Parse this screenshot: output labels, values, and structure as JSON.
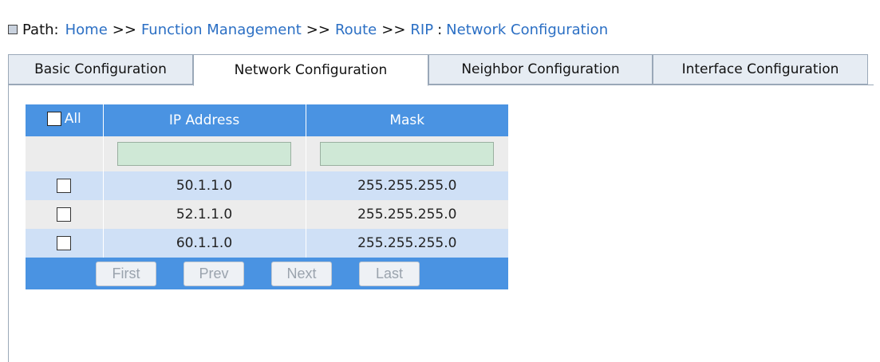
{
  "path": {
    "label": "Path:",
    "crumbs": [
      "Home",
      "Function Management",
      "Route",
      "RIP",
      "Network Configuration"
    ],
    "separator": ">>",
    "colon": ":"
  },
  "tabs": [
    {
      "label": "Basic Configuration",
      "active": false
    },
    {
      "label": "Network Configuration",
      "active": true
    },
    {
      "label": "Neighbor Configuration",
      "active": false
    },
    {
      "label": "Interface Configuration",
      "active": false
    }
  ],
  "table": {
    "headers": {
      "all": "All",
      "ip": "IP Address",
      "mask": "Mask"
    },
    "filter": {
      "ip_value": "",
      "mask_value": ""
    },
    "rows": [
      {
        "ip": "50.1.1.0",
        "mask": "255.255.255.0",
        "checked": false
      },
      {
        "ip": "52.1.1.0",
        "mask": "255.255.255.0",
        "checked": false
      },
      {
        "ip": "60.1.1.0",
        "mask": "255.255.255.0",
        "checked": false
      }
    ]
  },
  "pager": {
    "first": "First",
    "prev": "Prev",
    "next": "Next",
    "last": "Last"
  },
  "colors": {
    "header_blue": "#4a93e2",
    "row_blue": "#cfe0f6",
    "row_gray": "#ececec",
    "link": "#2b6fc4",
    "filter_green": "#cfe8d6"
  }
}
